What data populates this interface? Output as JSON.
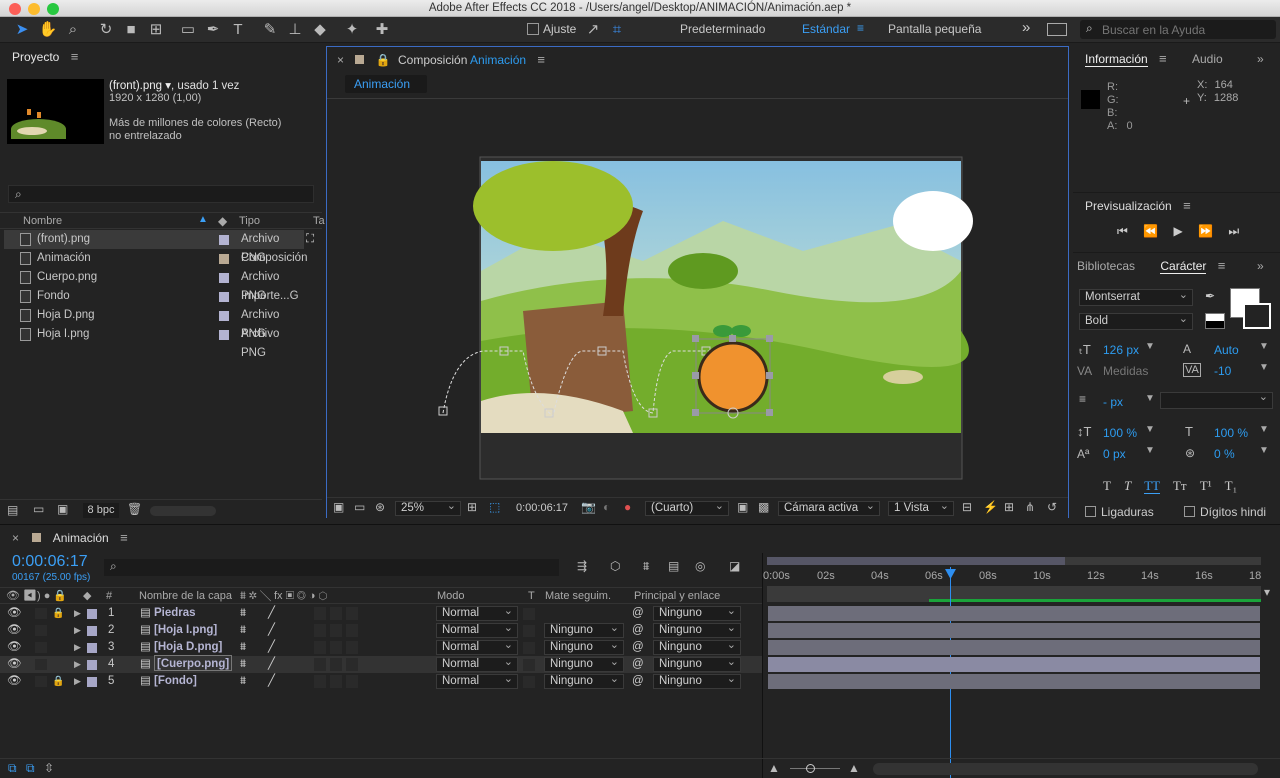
{
  "window": {
    "title": "Adobe After Effects CC 2018 - /Users/angel/Desktop/ANIMACIÓN/Animación.aep *"
  },
  "toolbar": {
    "snap_label": "Ajuste",
    "workspaces": [
      "Predeterminado",
      "Estándar",
      "Pantalla pequeña"
    ],
    "active_workspace": "Estándar",
    "search_placeholder": "Buscar en la Ayuda"
  },
  "project": {
    "title": "Proyecto",
    "selected": {
      "name": "(front).png ▾",
      "usage": ", usado 1 vez",
      "dims": "1920 x 1280 (1,00)",
      "colors": "Más de millones de colores (Recto)",
      "interlace": "no entrelazado"
    },
    "search_placeholder": "",
    "columns": {
      "name": "Nombre",
      "type": "Tipo",
      "extra": "Ta"
    },
    "items": [
      {
        "name": "(front).png",
        "type": "Archivo PNG",
        "color": "#b3b3d1"
      },
      {
        "name": "Animación",
        "type": "Composición",
        "color": "#b9a993"
      },
      {
        "name": "Cuerpo.png",
        "type": "Archivo PNG",
        "color": "#b3b3d1"
      },
      {
        "name": "Fondo",
        "type": "Importe...G",
        "color": "#b3b3d1"
      },
      {
        "name": "Hoja D.png",
        "type": "Archivo PNG",
        "color": "#b3b3d1"
      },
      {
        "name": "Hoja I.png",
        "type": "Archivo PNG",
        "color": "#b3b3d1"
      }
    ],
    "bpc": "8 bpc"
  },
  "comp": {
    "title_prefix": "Composición",
    "title_name": "Animación",
    "tab": "Animación",
    "zoom": "25%",
    "timecode": "0:00:06:17",
    "resolution": "(Cuarto)",
    "camera": "Cámara activa",
    "views": "1 Vista"
  },
  "info": {
    "title": "Información",
    "audio": "Audio",
    "r": "R:",
    "g": "G:",
    "b": "B:",
    "a": "A:",
    "a_val": "0",
    "x_label": "X:",
    "x_val": "164",
    "y_label": "Y:",
    "y_val": "1288"
  },
  "preview": {
    "title": "Previsualización"
  },
  "character": {
    "lib": "Bibliotecas",
    "title": "Carácter",
    "font": "Montserrat",
    "style": "Bold",
    "size": "126 px",
    "leading": "Auto",
    "kerning": "Medidas",
    "tracking": "-10",
    "stroke": "- px",
    "vscale": "100 %",
    "hscale": "100 %",
    "baseline": "0 px",
    "tsume": "0 %",
    "ligatures": "Ligaduras",
    "hindi": "Dígitos hindi"
  },
  "timeline": {
    "tab": "Animación",
    "timecode": "0:00:06:17",
    "frames": "00167 (25.00 fps)",
    "columns": {
      "num": "#",
      "name": "Nombre de la capa",
      "mode": "Modo",
      "t": "T",
      "matte": "Mate seguim.",
      "parent": "Principal y enlace"
    },
    "ruler": [
      "0:00s",
      "02s",
      "04s",
      "06s",
      "08s",
      "10s",
      "12s",
      "14s",
      "16s",
      "18"
    ],
    "layers": [
      {
        "num": "1",
        "name": "Piedras",
        "mode": "Normal",
        "matte": "",
        "parent": "Ninguno",
        "color": "#a7a7c7",
        "lock": true
      },
      {
        "num": "2",
        "name": "[Hoja I.png]",
        "mode": "Normal",
        "matte": "Ninguno",
        "parent": "Ninguno",
        "color": "#a7a7c7",
        "lock": false
      },
      {
        "num": "3",
        "name": "[Hoja D.png]",
        "mode": "Normal",
        "matte": "Ninguno",
        "parent": "Ninguno",
        "color": "#a7a7c7",
        "lock": false
      },
      {
        "num": "4",
        "name": "[Cuerpo.png]",
        "mode": "Normal",
        "matte": "Ninguno",
        "parent": "Ninguno",
        "color": "#a7a7c7",
        "lock": false
      },
      {
        "num": "5",
        "name": "[Fondo]",
        "mode": "Normal",
        "matte": "Ninguno",
        "parent": "Ninguno",
        "color": "#a7a7c7",
        "lock": true
      }
    ]
  }
}
